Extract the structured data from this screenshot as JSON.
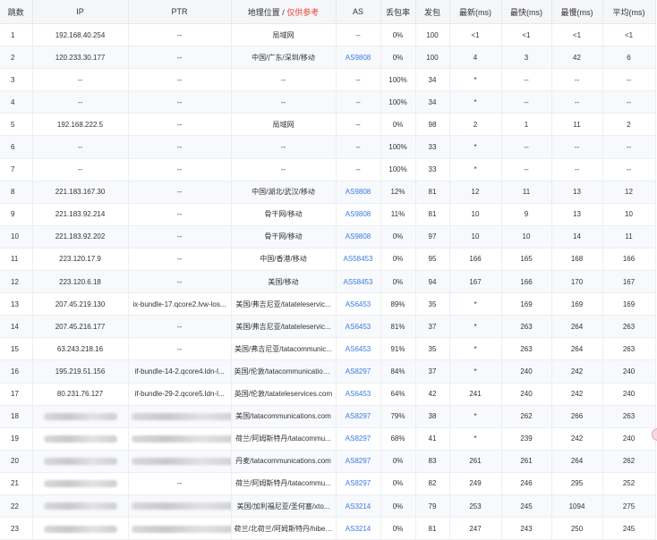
{
  "header": {
    "hop": "跳数",
    "ip": "IP",
    "ptr": "PTR",
    "geo": "地理位置 / ",
    "geo_note": "仅供参考",
    "as": "AS",
    "loss": "丢包率",
    "sent": "发包",
    "last": "最新(ms)",
    "best": "最快(ms)",
    "worst": "最慢(ms)",
    "avg": "平均(ms)"
  },
  "rows": [
    {
      "hop": "1",
      "ip": "192.168.40.254",
      "ptr": "--",
      "geo": "局域网",
      "as": "--",
      "loss": "0%",
      "sent": "100",
      "last": "<1",
      "best": "<1",
      "worst": "<1",
      "avg": "<1"
    },
    {
      "hop": "2",
      "ip": "120.233.30.177",
      "ptr": "--",
      "geo": "中国/广东/深圳/移动",
      "as": "AS9808",
      "loss": "0%",
      "sent": "100",
      "last": "4",
      "best": "3",
      "worst": "42",
      "avg": "6"
    },
    {
      "hop": "3",
      "ip": "--",
      "ptr": "--",
      "geo": "--",
      "as": "--",
      "loss": "100%",
      "sent": "34",
      "last": "*",
      "best": "--",
      "worst": "--",
      "avg": "--"
    },
    {
      "hop": "4",
      "ip": "--",
      "ptr": "--",
      "geo": "--",
      "as": "--",
      "loss": "100%",
      "sent": "34",
      "last": "*",
      "best": "--",
      "worst": "--",
      "avg": "--"
    },
    {
      "hop": "5",
      "ip": "192.168.222.5",
      "ptr": "--",
      "geo": "局域网",
      "as": "--",
      "loss": "0%",
      "sent": "98",
      "last": "2",
      "best": "1",
      "worst": "11",
      "avg": "2"
    },
    {
      "hop": "6",
      "ip": "--",
      "ptr": "--",
      "geo": "--",
      "as": "--",
      "loss": "100%",
      "sent": "33",
      "last": "*",
      "best": "--",
      "worst": "--",
      "avg": "--"
    },
    {
      "hop": "7",
      "ip": "--",
      "ptr": "--",
      "geo": "--",
      "as": "--",
      "loss": "100%",
      "sent": "33",
      "last": "*",
      "best": "--",
      "worst": "--",
      "avg": "--"
    },
    {
      "hop": "8",
      "ip": "221.183.167.30",
      "ptr": "--",
      "geo": "中国/湖北/武汉/移动",
      "as": "AS9808",
      "loss": "12%",
      "sent": "81",
      "last": "12",
      "best": "11",
      "worst": "13",
      "avg": "12"
    },
    {
      "hop": "9",
      "ip": "221.183.92.214",
      "ptr": "--",
      "geo": "骨干网/移动",
      "as": "AS9808",
      "loss": "11%",
      "sent": "81",
      "last": "10",
      "best": "9",
      "worst": "13",
      "avg": "10"
    },
    {
      "hop": "10",
      "ip": "221.183.92.202",
      "ptr": "--",
      "geo": "骨干网/移动",
      "as": "AS9808",
      "loss": "0%",
      "sent": "97",
      "last": "10",
      "best": "10",
      "worst": "14",
      "avg": "11"
    },
    {
      "hop": "11",
      "ip": "223.120.17.9",
      "ptr": "--",
      "geo": "中国/香港/移动",
      "as": "AS58453",
      "loss": "0%",
      "sent": "95",
      "last": "166",
      "best": "165",
      "worst": "168",
      "avg": "166"
    },
    {
      "hop": "12",
      "ip": "223.120.6.18",
      "ptr": "--",
      "geo": "美国/移动",
      "as": "AS58453",
      "loss": "0%",
      "sent": "94",
      "last": "167",
      "best": "166",
      "worst": "170",
      "avg": "167"
    },
    {
      "hop": "13",
      "ip": "207.45.219.130",
      "ptr": "ix-bundle-17.qcore2.lvw-los...",
      "geo": "美国/弗吉尼亚/tatateleservic...",
      "as": "AS6453",
      "loss": "89%",
      "sent": "35",
      "last": "*",
      "best": "169",
      "worst": "169",
      "avg": "169"
    },
    {
      "hop": "14",
      "ip": "207.45.216.177",
      "ptr": "--",
      "geo": "美国/弗吉尼亚/tatateleservic...",
      "as": "AS6453",
      "loss": "81%",
      "sent": "37",
      "last": "*",
      "best": "263",
      "worst": "264",
      "avg": "263"
    },
    {
      "hop": "15",
      "ip": "63.243.218.16",
      "ptr": "--",
      "geo": "美国/弗吉尼亚/tatacommunic...",
      "as": "AS6453",
      "loss": "91%",
      "sent": "35",
      "last": "*",
      "best": "263",
      "worst": "264",
      "avg": "263"
    },
    {
      "hop": "16",
      "ip": "195.219.51.156",
      "ptr": "if-bundle-14-2.qcore4.ldn-l...",
      "geo": "英国/伦敦/tatacommunications...",
      "as": "AS8297",
      "loss": "84%",
      "sent": "37",
      "last": "*",
      "best": "240",
      "worst": "242",
      "avg": "240"
    },
    {
      "hop": "17",
      "ip": "80.231.76.127",
      "ptr": "if-bundle-29-2.qcore5.ldn-l...",
      "geo": "英国/伦敦/tatateleservices.com",
      "as": "AS6453",
      "loss": "64%",
      "sent": "42",
      "last": "241",
      "best": "240",
      "worst": "242",
      "avg": "240"
    },
    {
      "hop": "18",
      "ip": "",
      "ptr": "",
      "geo": "美国/tatacommunications.com",
      "as": "AS8297",
      "loss": "79%",
      "sent": "38",
      "last": "*",
      "best": "262",
      "worst": "266",
      "avg": "263"
    },
    {
      "hop": "19",
      "ip": "",
      "ptr": "",
      "geo": "荷兰/阿姆斯特丹/tatacommu...",
      "as": "AS8297",
      "loss": "68%",
      "sent": "41",
      "last": "*",
      "best": "239",
      "worst": "242",
      "avg": "240"
    },
    {
      "hop": "20",
      "ip": "",
      "ptr": "",
      "geo": "丹麦/tatacommunications.com",
      "as": "AS8297",
      "loss": "0%",
      "sent": "83",
      "last": "261",
      "best": "261",
      "worst": "264",
      "avg": "262"
    },
    {
      "hop": "21",
      "ip": "",
      "ptr": "--",
      "geo": "荷兰/阿姆斯特丹/tatacommu...",
      "as": "AS8297",
      "loss": "0%",
      "sent": "82",
      "last": "249",
      "best": "246",
      "worst": "295",
      "avg": "252"
    },
    {
      "hop": "22",
      "ip": "",
      "ptr": "",
      "geo": "美国/加利福尼亚/圣何塞/xto...",
      "as": "AS3214",
      "loss": "0%",
      "sent": "79",
      "last": "253",
      "best": "245",
      "worst": "1094",
      "avg": "275"
    },
    {
      "hop": "23",
      "ip": "",
      "ptr": "",
      "geo": "荷兰/北荷兰/阿姆斯特丹/hiber...",
      "as": "AS3214",
      "loss": "0%",
      "sent": "81",
      "last": "247",
      "best": "243",
      "worst": "250",
      "avg": "245"
    }
  ]
}
